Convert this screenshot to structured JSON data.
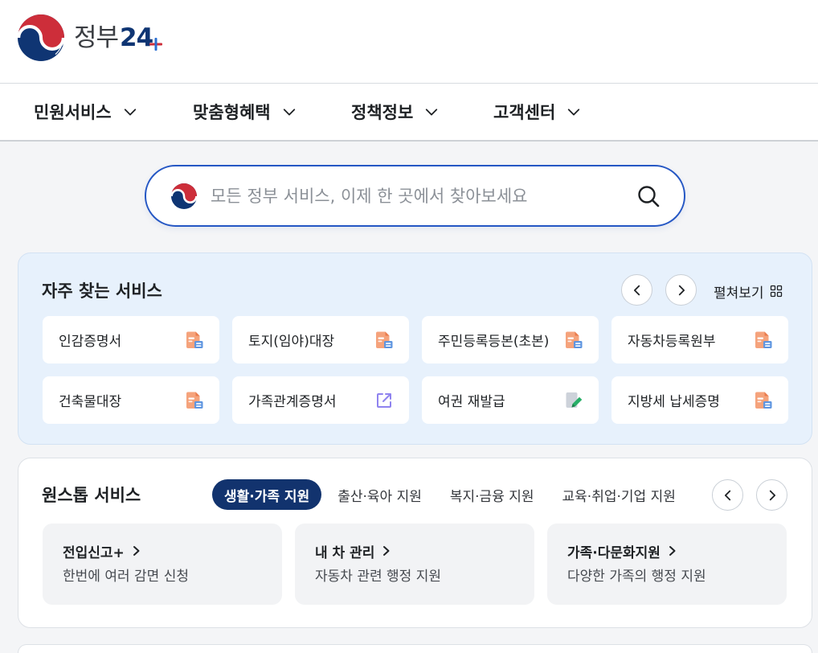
{
  "header": {
    "logo_text": "정부",
    "logo_number": "24",
    "emblem_icon": "taegeuk-emblem-icon"
  },
  "nav": {
    "items": [
      {
        "label": "민원서비스",
        "icon": "chevron-down-icon"
      },
      {
        "label": "맞춤형혜택",
        "icon": "chevron-down-icon"
      },
      {
        "label": "정책정보",
        "icon": "chevron-down-icon"
      },
      {
        "label": "고객센터",
        "icon": "chevron-down-icon"
      }
    ]
  },
  "search": {
    "placeholder": "모든 정부 서비스, 이제 한 곳에서 찾아보세요",
    "icon": "search-icon"
  },
  "frequent": {
    "title": "자주 찾는 서비스",
    "expand_label": "펼쳐보기",
    "expand_icon": "grid-icon",
    "items": [
      {
        "label": "인감증명서",
        "icon": "pdf-icon"
      },
      {
        "label": "토지(임야)대장",
        "icon": "pdf-icon"
      },
      {
        "label": "주민등록등본(초본)",
        "icon": "pdf-icon"
      },
      {
        "label": "자동차등록원부",
        "icon": "pdf-icon"
      },
      {
        "label": "건축물대장",
        "icon": "pdf-icon"
      },
      {
        "label": "가족관계증명서",
        "icon": "external-link-icon"
      },
      {
        "label": "여권 재발급",
        "icon": "edit-icon"
      },
      {
        "label": "지방세 납세증명",
        "icon": "pdf-icon"
      }
    ]
  },
  "onestop": {
    "title": "원스톱 서비스",
    "tabs": [
      {
        "label": "생활·가족 지원",
        "active": true
      },
      {
        "label": "출산·육아 지원",
        "active": false
      },
      {
        "label": "복지·금융 지원",
        "active": false
      },
      {
        "label": "교육·취업·기업 지원",
        "active": false
      }
    ],
    "cards": [
      {
        "title": "전입신고+",
        "description": "한번에 여러 감면 신청"
      },
      {
        "title": "내 차 관리",
        "description": "자동차 관련 행정 지원"
      },
      {
        "title": "가족·다문화지원",
        "description": "다양한 가족의 행정 지원"
      }
    ]
  },
  "colors": {
    "brand_navy": "#0f3573",
    "brand_red": "#cd2e3a",
    "search_border": "#2557c4",
    "active_tab": "#12336e",
    "frequent_bg": "#e7f1fc",
    "page_bg": "#f4f5f7"
  }
}
